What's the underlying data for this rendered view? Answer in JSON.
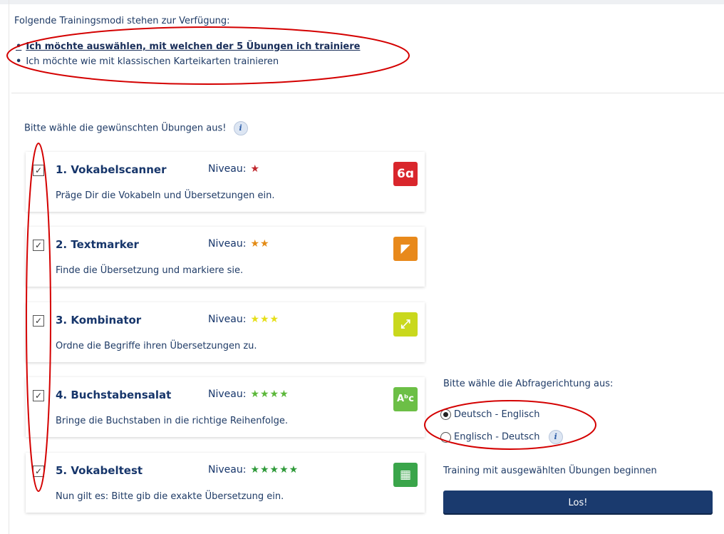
{
  "intro": "Folgende Trainingsmodi stehen zur Verfügung:",
  "modes": [
    {
      "label": "Ich möchte auswählen, mit welchen der 5 Übungen ich trainiere",
      "selected": true
    },
    {
      "label": "Ich möchte wie mit klassischen Karteikarten trainieren",
      "selected": false
    }
  ],
  "exercise_prompt": "Bitte wähle die gewünschten Übungen aus!",
  "info_glyph": "i",
  "niveau_label": "Niveau:",
  "exercises": [
    {
      "title": "1. Vokabelscanner",
      "stars": "★",
      "star_color": "#c0272d",
      "desc": "Präge Dir die Vokabeln und Übersetzungen ein.",
      "icon": "glasses-icon",
      "icon_glyph": "6ɑ",
      "icon_color": "#d9262c",
      "checked": true
    },
    {
      "title": "2. Textmarker",
      "stars": "★★",
      "star_color": "#e38b15",
      "desc": "Finde die Übersetzung und markiere sie.",
      "icon": "highlighter-icon",
      "icon_glyph": "◤",
      "icon_color": "#e8891b",
      "checked": true
    },
    {
      "title": "3. Kombinator",
      "stars": "★★★",
      "star_color": "#e6df1a",
      "desc": "Ordne die Begriffe ihren Übersetzungen zu.",
      "icon": "connect-arrows-icon",
      "icon_glyph": "⤢",
      "icon_color": "#c9d81d",
      "checked": true
    },
    {
      "title": "4. Buchstabensalat",
      "stars": "★★★★",
      "star_color": "#5cb83a",
      "desc": "Bringe die Buchstaben in die richtige Reihenfolge.",
      "icon": "letters-icon",
      "icon_glyph": "Aᵇc",
      "icon_color": "#6cbf46",
      "checked": true
    },
    {
      "title": "5. Vokabeltest",
      "stars": "★★★★★",
      "star_color": "#2f9a3a",
      "desc": "Nun gilt es: Bitte gib die exakte Übersetzung ein.",
      "icon": "keyboard-icon",
      "icon_glyph": "▦",
      "icon_color": "#3aa54a",
      "checked": true
    }
  ],
  "direction": {
    "label": "Bitte wähle die Abfragerichtung aus:",
    "options": [
      {
        "label": "Deutsch - Englisch",
        "checked": true
      },
      {
        "label": "Englisch - Deutsch",
        "checked": false
      }
    ]
  },
  "start_label": "Training mit ausgewählten Übungen beginnen",
  "start_button": "Los!",
  "colors": {
    "primary": "#1a3a6e",
    "text": "#1f3b66",
    "annotation": "#d40000"
  }
}
